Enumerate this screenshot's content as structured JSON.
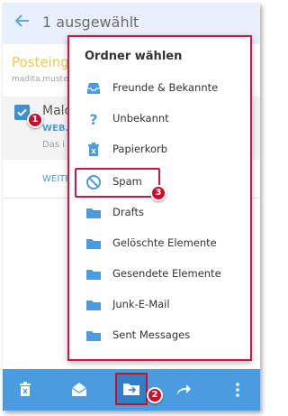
{
  "header": {
    "title": "1 ausgewählt"
  },
  "inbox": {
    "title": "Posteinga",
    "subtitle": "madita.musterm"
  },
  "message": {
    "sender": "Malc",
    "org": "WEB.",
    "preview": "Das i"
  },
  "list": {
    "more_link": "WEITE"
  },
  "popup": {
    "title": "Ordner wählen",
    "folders": [
      {
        "label": "Freunde & Bekannte",
        "icon": "inbox-tray-icon"
      },
      {
        "label": "Unbekannt",
        "icon": "question-icon"
      },
      {
        "label": "Papierkorb",
        "icon": "trash-icon"
      },
      {
        "label": "Spam",
        "icon": "block-icon"
      },
      {
        "label": "Drafts",
        "icon": "folder-icon"
      },
      {
        "label": "Gelöschte Elemente",
        "icon": "folder-icon"
      },
      {
        "label": "Gesendete Elemente",
        "icon": "folder-icon"
      },
      {
        "label": "Junk-E-Mail",
        "icon": "folder-icon"
      },
      {
        "label": "Sent Messages",
        "icon": "folder-icon"
      }
    ]
  },
  "badges": {
    "step1": "1",
    "step2": "2",
    "step3": "3"
  },
  "colors": {
    "accent": "#4a9be0",
    "highlight": "#c8184a",
    "header_bg": "#e8f1fb",
    "inbox_title": "#f2c94c"
  }
}
